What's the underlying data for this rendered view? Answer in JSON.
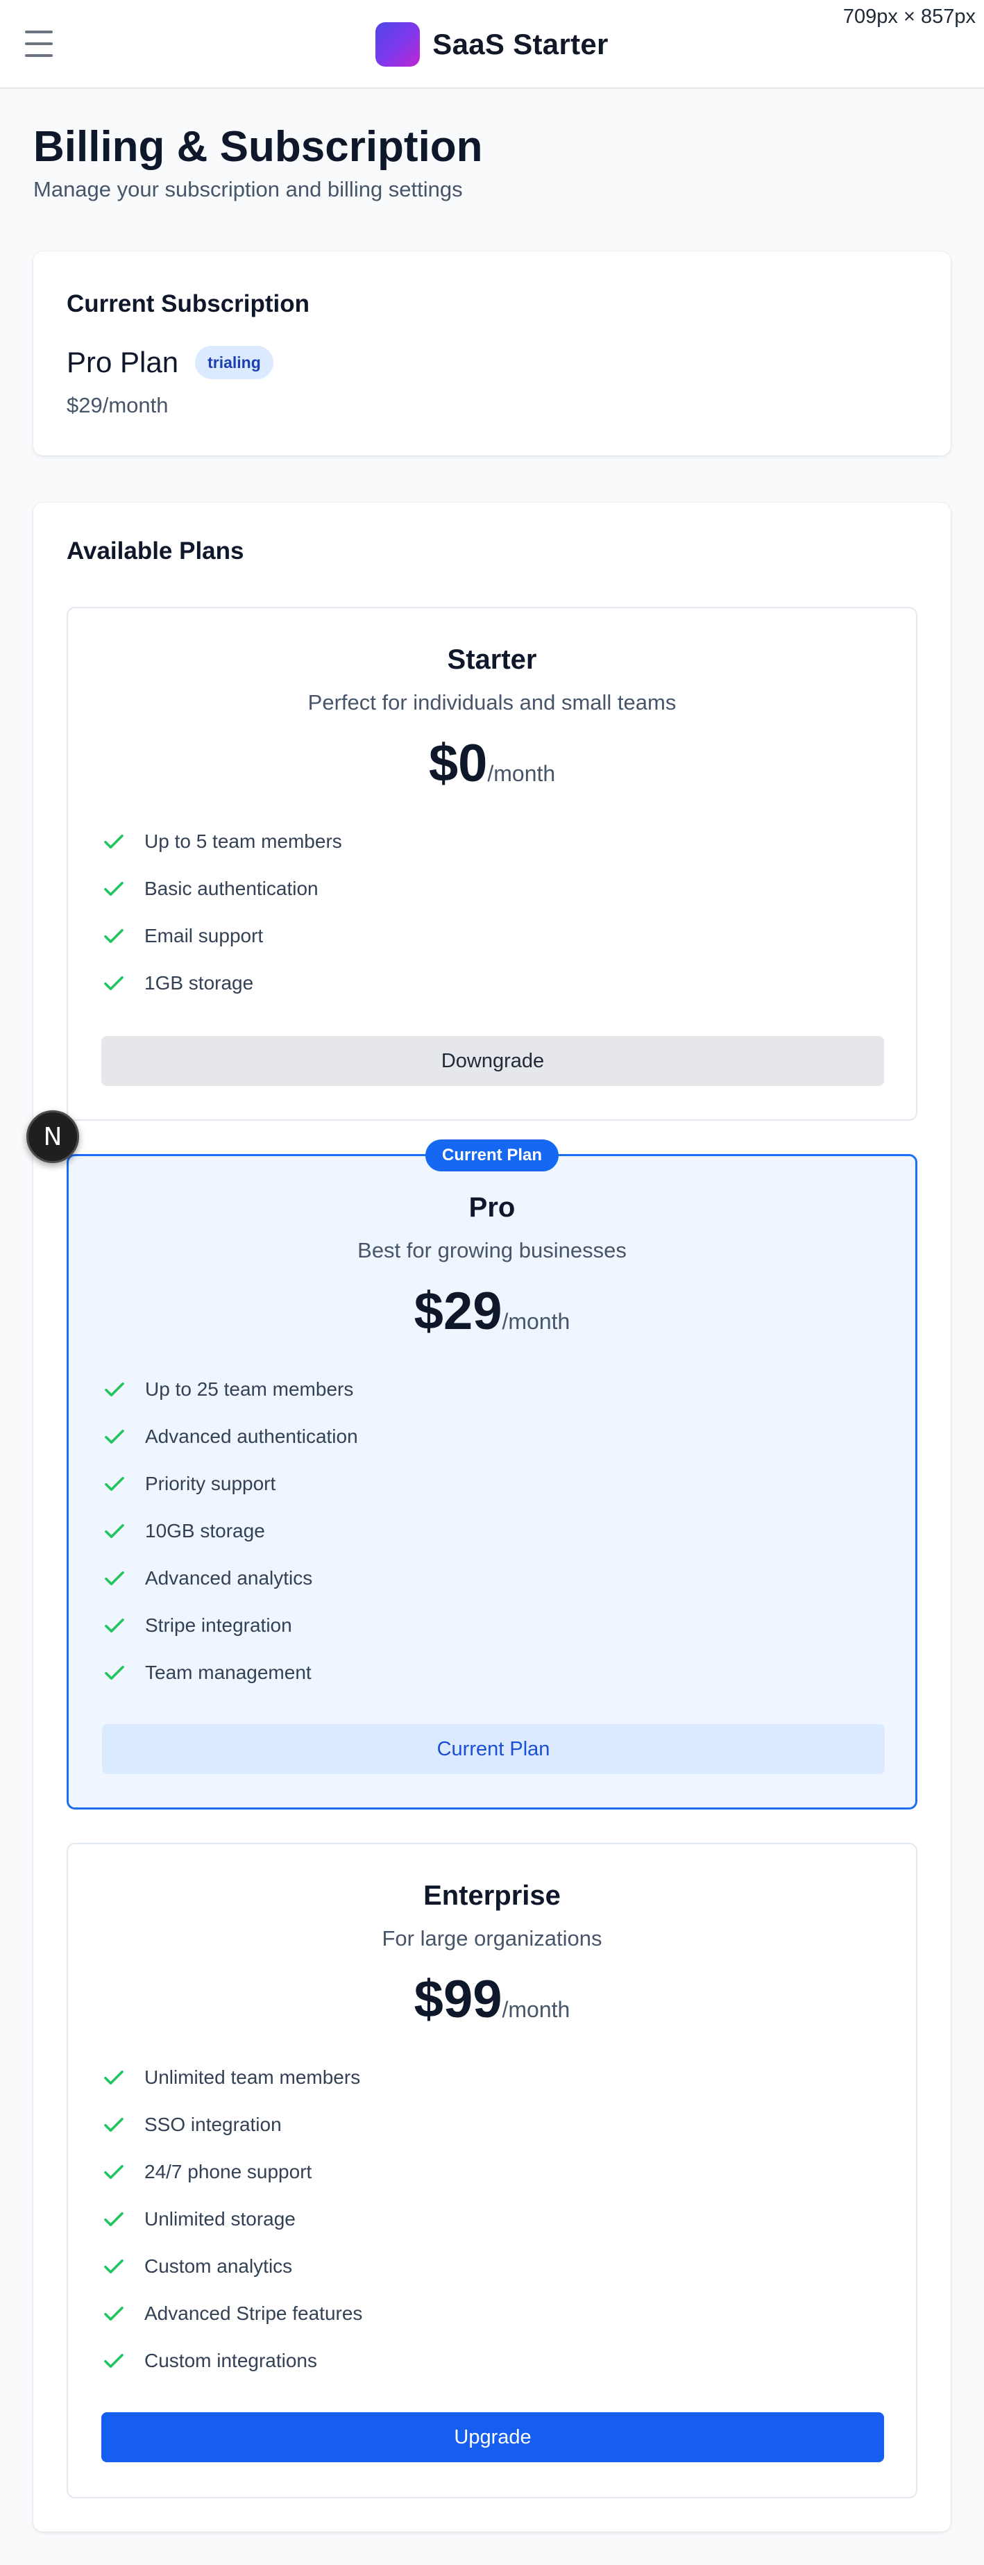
{
  "viewport_readout": "709px × 857px",
  "header": {
    "app_name": "SaaS Starter",
    "menu_icon": "hamburger-menu-icon",
    "logo_colors": [
      "#4f46e5",
      "#7c3aed",
      "#c026d3"
    ]
  },
  "page": {
    "title": "Billing & Subscription",
    "subtitle": "Manage your subscription and billing settings"
  },
  "subscription": {
    "section_title": "Current Subscription",
    "plan_name": "Pro Plan",
    "status": "trialing",
    "price": "$29/month"
  },
  "plans_section": {
    "title": "Available Plans",
    "plans": [
      {
        "name": "Starter",
        "description": "Perfect for individuals and small teams",
        "price": "$0",
        "period": "/month",
        "features": [
          "Up to 5 team members",
          "Basic authentication",
          "Email support",
          "1GB storage"
        ],
        "button": "Downgrade"
      },
      {
        "name": "Pro",
        "badge": "Current Plan",
        "description": "Best for growing businesses",
        "price": "$29",
        "period": "/month",
        "features": [
          "Up to 25 team members",
          "Advanced authentication",
          "Priority support",
          "10GB storage",
          "Advanced analytics",
          "Stripe integration",
          "Team management"
        ],
        "button": "Current Plan"
      },
      {
        "name": "Enterprise",
        "description": "For large organizations",
        "price": "$99",
        "period": "/month",
        "features": [
          "Unlimited team members",
          "SSO integration",
          "24/7 phone support",
          "Unlimited storage",
          "Custom analytics",
          "Advanced Stripe features",
          "Custom integrations"
        ],
        "button": "Upgrade"
      }
    ]
  },
  "dev_badge": {
    "letter": "N"
  },
  "colors": {
    "accent": "#155eef",
    "check": "#22c55e",
    "current_border": "#1d6ff2",
    "current_bg": "#eff6ff"
  }
}
